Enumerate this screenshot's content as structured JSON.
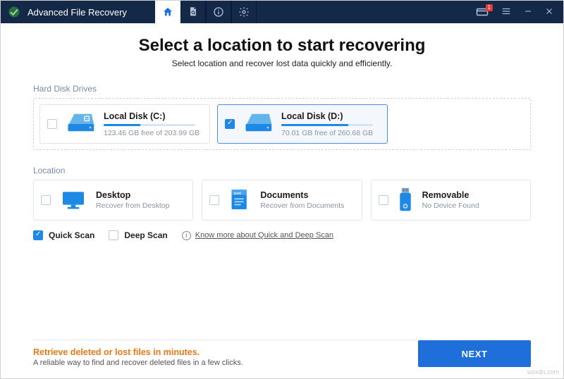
{
  "app": {
    "title": "Advanced File Recovery"
  },
  "notifications": {
    "count": "1"
  },
  "header": {
    "heading": "Select a location to start recovering",
    "subheading": "Select location and recover lost data quickly and efficiently."
  },
  "sections": {
    "drives": "Hard Disk Drives",
    "location": "Location"
  },
  "drives": [
    {
      "name": "Local Disk (C:)",
      "free": "123.46 GB free of 203.99 GB",
      "fill_pct": 40,
      "checked": false
    },
    {
      "name": "Local Disk (D:)",
      "free": "70.01 GB free of 260.68 GB",
      "fill_pct": 73,
      "checked": true
    }
  ],
  "locations": [
    {
      "name": "Desktop",
      "sub": "Recover from Desktop"
    },
    {
      "name": "Documents",
      "sub": "Recover from Documents"
    },
    {
      "name": "Removable",
      "sub": "No Device Found"
    }
  ],
  "scan": {
    "quick": "Quick Scan",
    "deep": "Deep Scan",
    "know_more": "Know more about Quick and Deep Scan"
  },
  "footer": {
    "title": "Retrieve deleted or lost files in minutes.",
    "sub": "A reliable way to find and recover deleted files in a few clicks.",
    "next": "NEXT"
  },
  "watermark": "wsxdn.com"
}
